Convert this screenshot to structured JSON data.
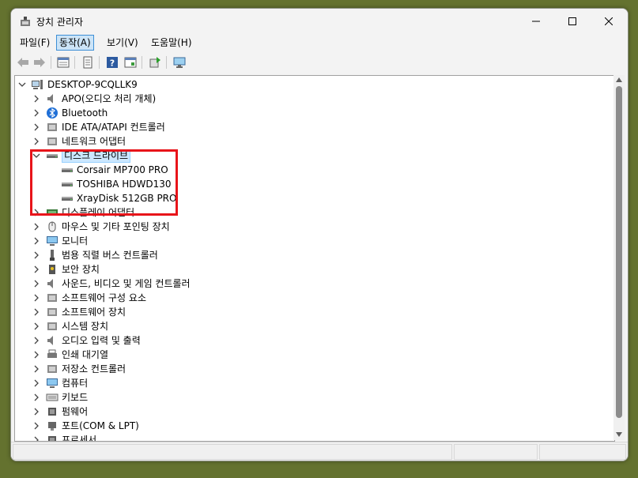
{
  "window": {
    "title": "장치 관리자"
  },
  "menu": [
    {
      "label": "파일(F)",
      "active": false
    },
    {
      "label": "동작(A)",
      "active": true
    },
    {
      "label": "보기(V)",
      "active": false
    },
    {
      "label": "도움말(H)",
      "active": false
    }
  ],
  "toolbar": [
    "back-icon",
    "forward-icon",
    "properties-icon",
    "page-icon",
    "help-icon",
    "view-icon",
    "update-driver-icon",
    "monitor-icon"
  ],
  "tree": {
    "root": "DESKTOP-9CQLLK9",
    "categories": [
      "APO(오디오 처리 개체)",
      "Bluetooth",
      "IDE ATA/ATAPI 컨트롤러",
      "네트워크 어댑터",
      "디스크 드라이브",
      "디스플레이 어댑터",
      "마우스 및 기타 포인팅 장치",
      "모니터",
      "범용 직렬 버스 컨트롤러",
      "보안 장치",
      "사운드, 비디오 및 게임 컨트롤러",
      "소프트웨어 구성 요소",
      "소프트웨어 장치",
      "시스템 장치",
      "오디오 입력 및 출력",
      "인쇄 대기열",
      "저장소 컨트롤러",
      "컴퓨터",
      "키보드",
      "펌웨어",
      "포트(COM & LPT)",
      "프로세서"
    ],
    "expanded_index": 4,
    "disk_drives": [
      "Corsair MP700 PRO",
      "TOSHIBA HDWD130",
      "XrayDisk 512GB PRO"
    ]
  },
  "colors": {
    "desktop": "#64722f",
    "highlight": "#e8141a",
    "selection": "#cce8ff"
  }
}
